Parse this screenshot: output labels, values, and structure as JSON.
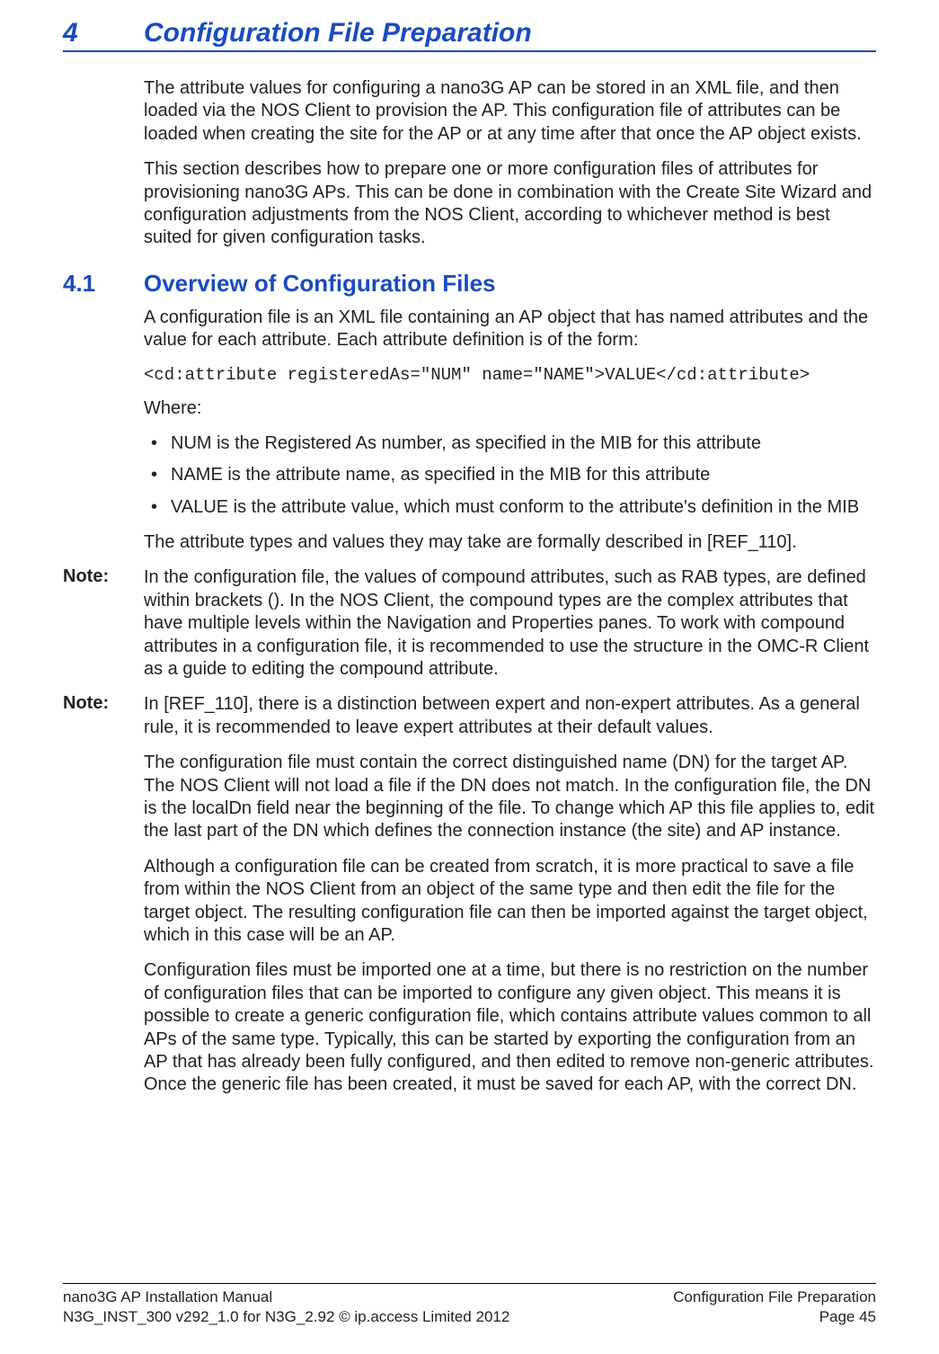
{
  "chapter": {
    "number": "4",
    "title": "Configuration File Preparation"
  },
  "intro": {
    "p1": "The attribute values for configuring a nano3G AP can be stored in an XML file, and then loaded via the NOS Client to provision the AP. This configuration file of attributes can be loaded when creating the site for the AP or at any time after that once the AP object exists.",
    "p2": "This section describes how to prepare one or more configuration files of attributes for provisioning nano3G APs. This can be done in combination with the Create Site Wizard and configuration adjustments from the NOS Client, according to whichever method is best suited for given configuration tasks."
  },
  "section": {
    "number": "4.1",
    "title": "Overview of Configuration Files",
    "p1": "A configuration file is an XML file containing an AP object that has named attributes and the value for each attribute. Each attribute definition is of the form:",
    "code": "<cd:attribute registeredAs=\"NUM\" name=\"NAME\">VALUE</cd:attribute>",
    "where": "Where:",
    "bullets": [
      "NUM is the Registered As number, as specified in the MIB for this attribute",
      "NAME is the attribute name, as specified in the MIB for this attribute",
      "VALUE is the attribute value, which must conform to the attribute's definition in the MIB"
    ],
    "p2": "The attribute types and values they may take are formally described in [REF_110].",
    "note1_label": "Note:",
    "note1": "In the configuration file, the values of compound attributes, such as RAB types, are defined within brackets (). In the NOS Client, the compound types are the complex attributes that have multiple levels within the Navigation and Properties panes. To work with compound attributes in a configuration file, it is recommended to use the structure in the OMC-R Client as a guide to editing the compound attribute.",
    "note2_label": "Note:",
    "note2": "In [REF_110], there is a distinction between expert and non-expert attributes. As a general rule, it is recommended to leave expert attributes at their default values.",
    "p3": "The configuration file must contain the correct distinguished name (DN) for the target AP. The NOS Client will not load a file if the DN does not match. In the configuration file, the DN is the localDn field near the beginning of the file. To change which AP this file applies to, edit the last part of the DN which defines the connection instance (the site) and AP instance.",
    "p4": "Although a configuration file can be created from scratch, it is more practical to save a file from within the NOS Client from an object of the same type and then edit the file for the target object. The resulting configuration file can then be imported against the target object, which in this case will be an AP.",
    "p5": "Configuration files must be imported one at a time, but there is no restriction on the number of configuration files that can be imported to configure any given object. This means it is possible to create a generic configuration file, which contains attribute values common to all APs of the same type. Typically, this can be started by exporting the configuration from an AP that has already been fully configured, and then edited to remove non-generic attributes. Once the generic file has been created, it must be saved for each AP, with the correct DN."
  },
  "footer": {
    "left1": "nano3G AP Installation Manual",
    "left2": "N3G_INST_300 v292_1.0 for N3G_2.92 © ip.access Limited 2012",
    "right1": "Configuration File Preparation",
    "right2": "Page 45"
  }
}
